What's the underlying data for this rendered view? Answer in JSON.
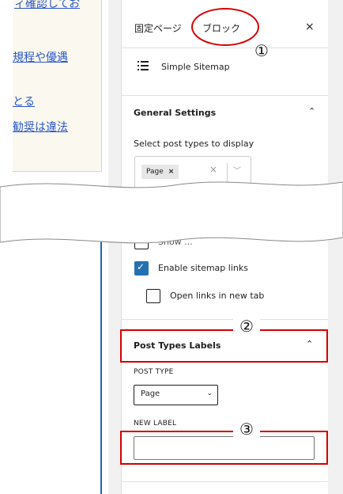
{
  "editor": {
    "links": [
      "ィ確認してお",
      "規程や優遇",
      "とる",
      "勧奨は違法"
    ]
  },
  "sidebar": {
    "tabs": [
      {
        "label": "固定ページ",
        "active": false
      },
      {
        "label": "ブロック",
        "active": true
      }
    ],
    "close_symbol": "×",
    "block": {
      "name": "Simple Sitemap",
      "icon": "list-icon"
    },
    "general_settings": {
      "title": "General Settings",
      "select_label": "Select post types to display",
      "selected_chip": "Page",
      "chip_remove": "×",
      "clear_symbol": "×",
      "partial_checkbox_label": "Show ...",
      "checkboxes": [
        {
          "label": "Enable sitemap links",
          "checked": true
        },
        {
          "label": "Open links in new tab",
          "checked": false
        }
      ]
    },
    "post_types_labels": {
      "title": "Post Types Labels",
      "post_type_label": "POST TYPE",
      "post_type_value": "Page",
      "new_label_label": "NEW LABEL",
      "new_label_value": ""
    }
  },
  "annotations": {
    "numbers": [
      "①",
      "②",
      "③"
    ],
    "color": "#d40000"
  },
  "colors": {
    "accent": "#2271b1",
    "link": "#2a55c8",
    "annotation": "#d40000"
  }
}
